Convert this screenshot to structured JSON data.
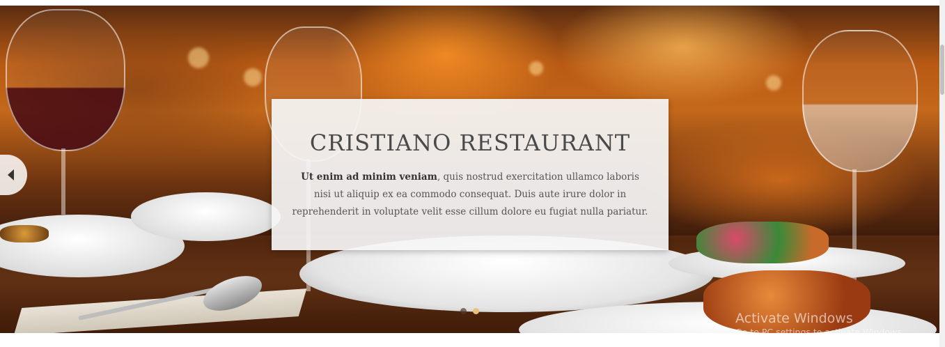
{
  "slide": {
    "title": "CRISTIANO RESTAURANT",
    "text_bold": "Ut enim ad minim veniam",
    "text_rest": ", quis nostrud exercitation ullamco laboris nisi ut aliquip ex ea commodo consequat. Duis aute irure dolor in reprehenderit in voluptate velit esse cillum dolore eu fugiat nulla pariatur."
  },
  "slider": {
    "prev_icon": "chevron-left-icon",
    "dots": [
      {
        "active": false
      },
      {
        "active": true
      }
    ]
  },
  "watermark": {
    "title": "Activate Windows",
    "subtitle": "Go to PC settings to activate Windows."
  },
  "colors": {
    "caption_bg": "#f5f5f5",
    "dot_active": "#e8c27a"
  }
}
